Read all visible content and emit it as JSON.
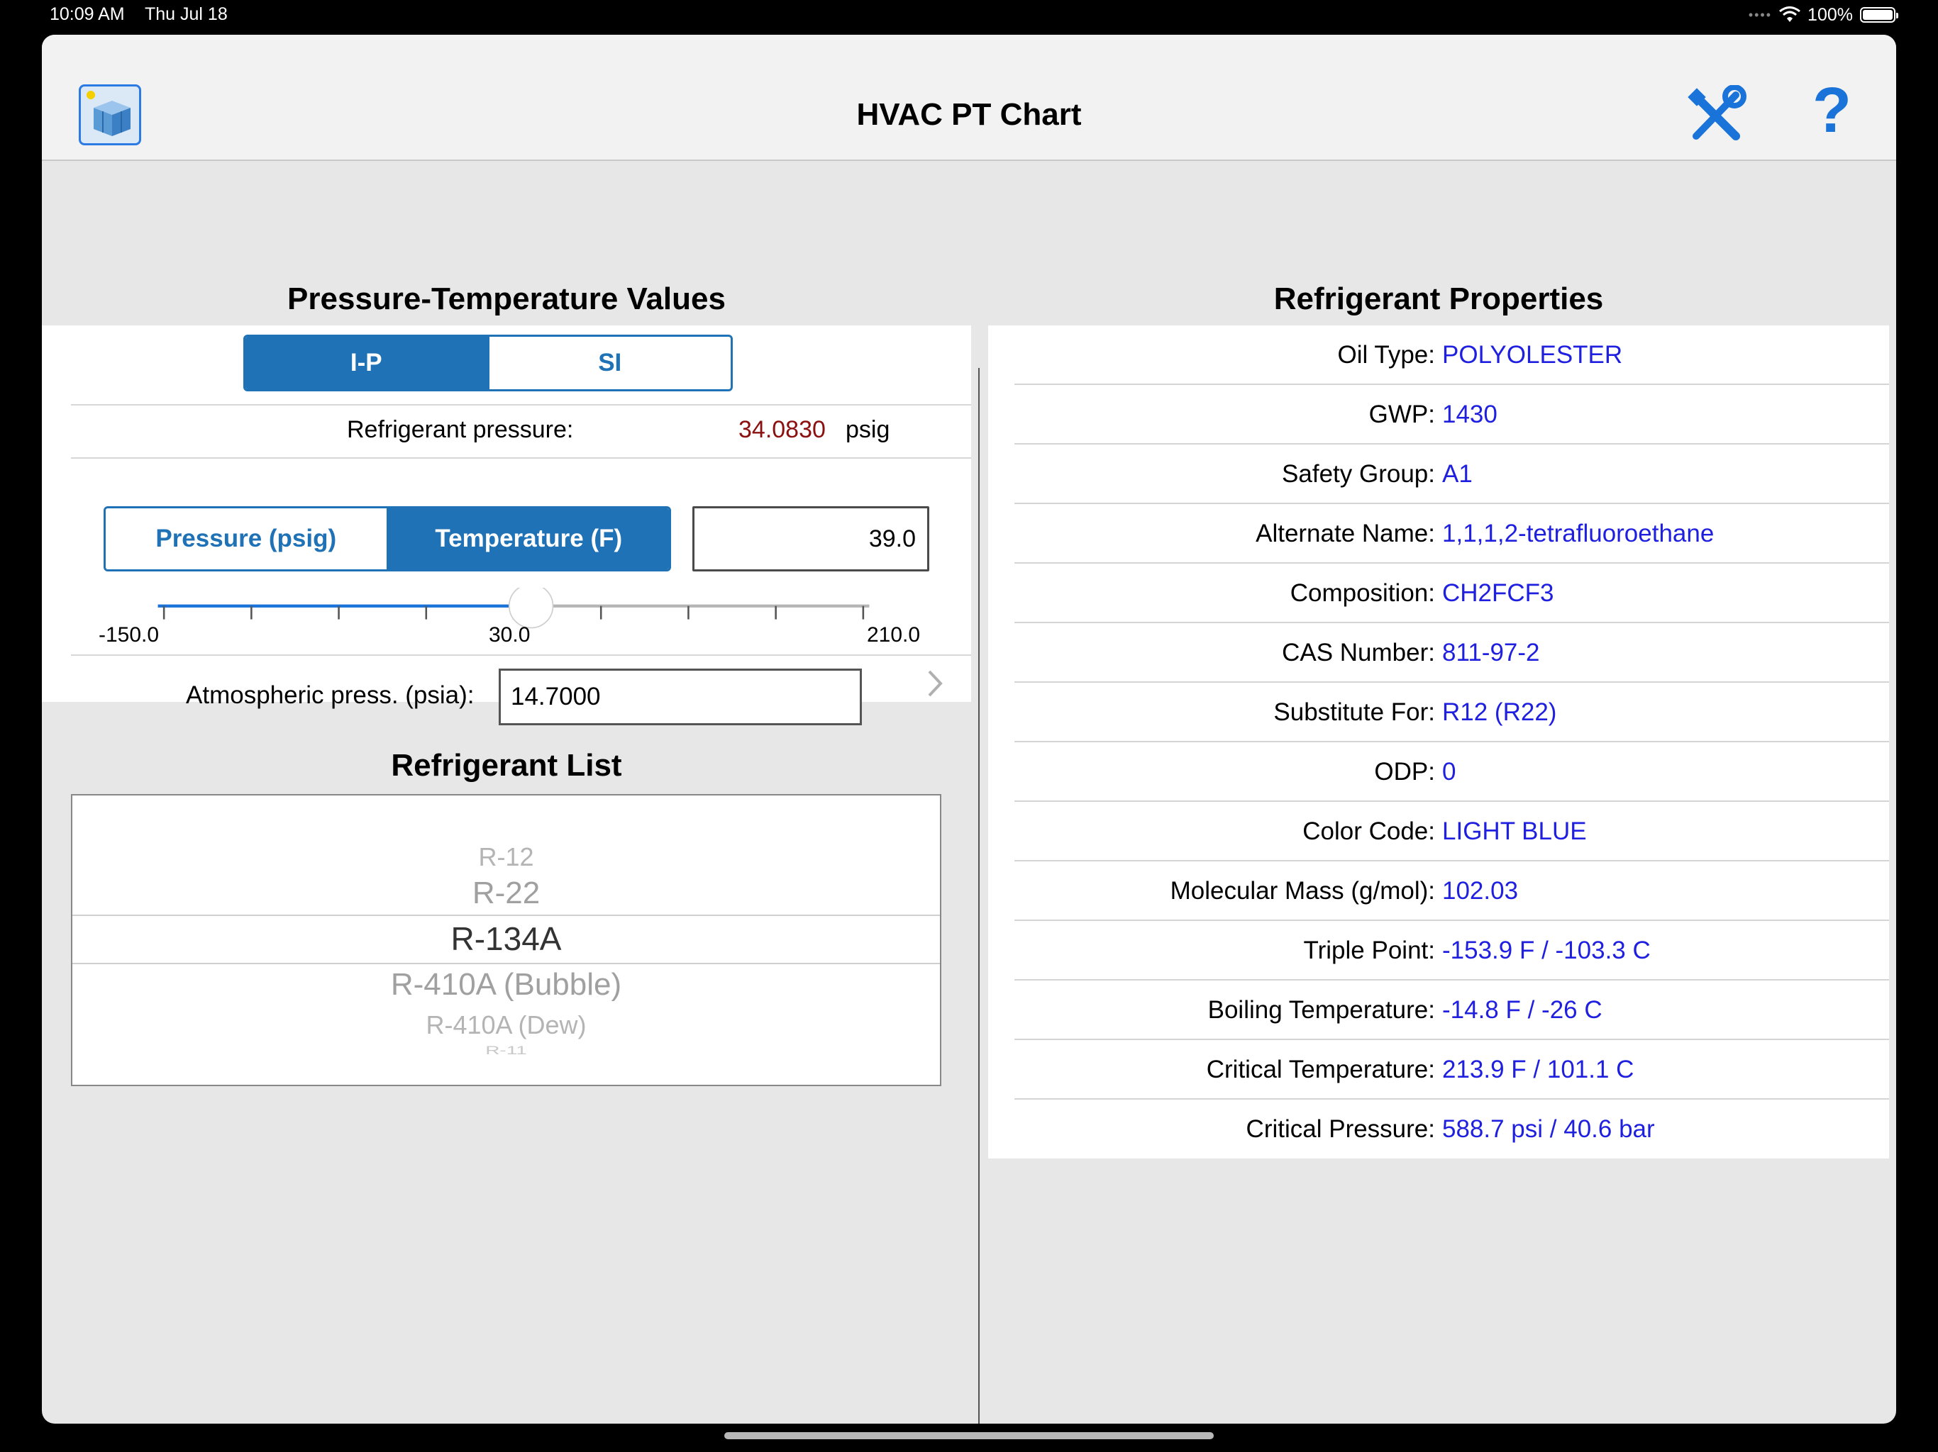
{
  "status_bar": {
    "time": "10:09 AM",
    "date": "Thu Jul 18",
    "battery": "100%"
  },
  "nav": {
    "title": "HVAC PT Chart",
    "left_icon": "app-logo-icon",
    "tools_icon": "tools-icon",
    "help_label": "?"
  },
  "pt_section": {
    "title": "Pressure-Temperature Values",
    "units": {
      "options": [
        "I-P",
        "SI"
      ],
      "selected": "I-P"
    },
    "pressure_label": "Refrigerant pressure:",
    "pressure_value": "34.0830",
    "pressure_unit": "psig",
    "mode": {
      "options": [
        "Pressure (psig)",
        "Temperature (F)"
      ],
      "selected": "Temperature (F)"
    },
    "input_value": "39.0",
    "slider": {
      "min": -150.0,
      "max": 210.0,
      "value": 39.0,
      "labels": [
        "-150.0",
        "30.0",
        "210.0"
      ]
    },
    "atm_label": "Atmospheric press. (psia):",
    "atm_value": "14.7000"
  },
  "list_section": {
    "title": "Refrigerant List",
    "items": [
      "R-12",
      "R-22",
      "R-134A",
      "R-410A (Bubble)",
      "R-410A (Dew)",
      "R-11"
    ],
    "selected": "R-134A"
  },
  "props_section": {
    "title": "Refrigerant Properties",
    "rows": [
      {
        "label": "Oil Type:",
        "value": "POLYOLESTER"
      },
      {
        "label": "GWP:",
        "value": "1430"
      },
      {
        "label": "Safety Group:",
        "value": "A1"
      },
      {
        "label": "Alternate Name:",
        "value": "1,1,1,2-tetrafluoroethane"
      },
      {
        "label": "Composition:",
        "value": "CH2FCF3"
      },
      {
        "label": "CAS Number:",
        "value": "811-97-2"
      },
      {
        "label": "Substitute For:",
        "value": "R12 (R22)"
      },
      {
        "label": "ODP:",
        "value": "0"
      },
      {
        "label": "Color Code:",
        "value": "LIGHT BLUE"
      },
      {
        "label": "Molecular Mass (g/mol):",
        "value": "102.03"
      },
      {
        "label": "Triple Point:",
        "value": "-153.9 F / -103.3 C"
      },
      {
        "label": "Boiling Temperature:",
        "value": "-14.8 F / -26 C"
      },
      {
        "label": "Critical Temperature:",
        "value": "213.9 F / 101.1 C"
      },
      {
        "label": "Critical Pressure:",
        "value": "588.7 psi / 40.6 bar"
      }
    ]
  },
  "colors": {
    "accent": "#1f72b5",
    "value_blue": "#1f1fe0",
    "pressure_red": "#8b1111",
    "icon_blue": "#1a73d9"
  }
}
